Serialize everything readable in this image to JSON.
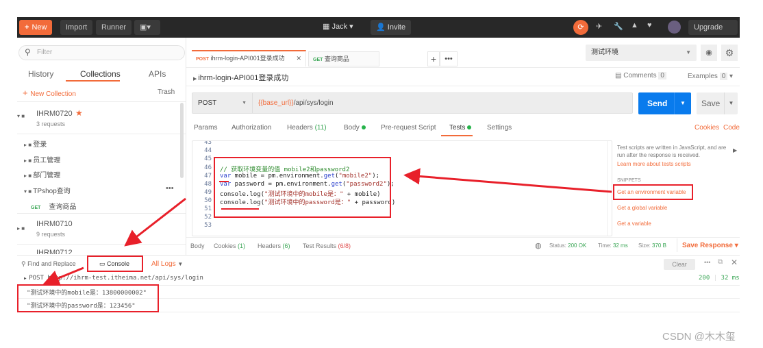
{
  "topbar": {
    "new": "New",
    "import": "Import",
    "runner": "Runner",
    "workspace": "Jack",
    "invite": "Invite",
    "upgrade": "Upgrade"
  },
  "sidebar": {
    "filter_placeholder": "Filter",
    "tabs": [
      "History",
      "Collections",
      "APIs"
    ],
    "active_tab": "Collections",
    "new_collection": "New Collection",
    "trash": "Trash",
    "collections": [
      {
        "name": "IHRM0720",
        "count": "3 requests",
        "starred": true,
        "folders": [
          "登录",
          "员工管理",
          "部门管理",
          "TPshop查询"
        ],
        "request": {
          "method": "GET",
          "name": "查询商品"
        }
      },
      {
        "name": "IHRM0710",
        "count": "9 requests"
      },
      {
        "name": "IHRM0712"
      }
    ]
  },
  "tabs": [
    {
      "method": "POST",
      "name": "ihrm-login-API001登录成功",
      "active": true
    },
    {
      "method": "GET",
      "name": "查询商品"
    }
  ],
  "environment": "测试环境",
  "request": {
    "title": "ihrm-login-API001登录成功",
    "comments": "Comments",
    "comments_count": "0",
    "examples": "Examples",
    "examples_count": "0",
    "method": "POST",
    "url_var": "{{base_url}}",
    "url_path": "/api/sys/login",
    "send": "Send",
    "save": "Save"
  },
  "subtabs": {
    "params": "Params",
    "authorization": "Authorization",
    "headers": "Headers",
    "headers_count": "(11)",
    "body": "Body",
    "prerequest": "Pre-request Script",
    "tests": "Tests",
    "settings": "Settings",
    "cookies": "Cookies",
    "code": "Code"
  },
  "editor": {
    "line_numbers": [
      "43",
      "44",
      "45",
      "46",
      "47",
      "48",
      "49",
      "50",
      "51",
      "52",
      "53"
    ],
    "comment": "// 获取环境变量的值 mobile2和password2",
    "l47": {
      "kw": "var",
      "a": " mobile = pm.environment.",
      "fn": "get",
      "b": "(",
      "s": "\"mobile2\"",
      "c": ");"
    },
    "l48": {
      "kw": "var",
      "a": " password = pm.environment.",
      "fn": "get",
      "b": "(",
      "s": "\"password2\"",
      "c": ");"
    },
    "l49": {
      "a": "console.log(",
      "s": "\"测试环境中的mobile是：\"",
      "c": " + mobile)"
    },
    "l50": {
      "a": "console.log(",
      "s": "\"测试环境中的password是：\"",
      "c": " + password)"
    }
  },
  "snippets": {
    "intro": "Test scripts are written in JavaScript, and are run after the response is received.",
    "learn": "Learn more about tests scripts",
    "heading": "SNIPPETS",
    "items": [
      "Get an environment variable",
      "Get a global variable",
      "Get a variable"
    ]
  },
  "response": {
    "body": "Body",
    "cookies": "Cookies",
    "cookies_count": "(1)",
    "headers": "Headers",
    "headers_count": "(6)",
    "tests": "Test Results",
    "tests_count": "(6/8)",
    "status_label": "Status:",
    "status": "200 OK",
    "time_label": "Time:",
    "time": "32 ms",
    "size_label": "Size:",
    "size": "370 B",
    "save": "Save Response"
  },
  "console": {
    "find": "Find and Replace",
    "console": "Console",
    "logs": "All Logs",
    "clear": "Clear",
    "request": "POST http://ihrm-test.itheima.net/api/sys/login",
    "status": "200",
    "time": "32 ms",
    "lines": [
      "\"测试环境中的mobile是：13800000002\"",
      "\"测试环境中的password是：123456\""
    ]
  },
  "watermark": "CSDN @木木玺",
  "colors": {
    "accent": "#f26b3a",
    "send": "#097bed",
    "annotation": "#e8202a"
  }
}
